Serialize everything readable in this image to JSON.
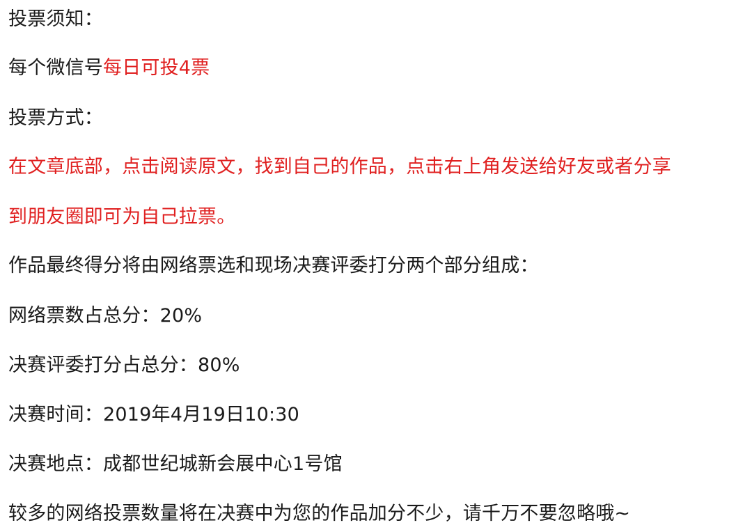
{
  "notice": {
    "title": "投票须知：",
    "rule_prefix": "每个微信号",
    "rule_highlight": "每日可投4票",
    "method_title": "投票方式：",
    "method_line1": "在文章底部，点击阅读原文，找到自己的作品，点击右上角发送给好友或者分享",
    "method_line2": "到朋友圈即可为自己拉票。",
    "score_intro": "作品最终得分将由网络票选和现场决赛评委打分两个部分组成：",
    "score_online": "网络票数占总分：20%",
    "score_judges": "决赛评委打分占总分：80%",
    "final_time": "决赛时间：2019年4月19日10:30",
    "final_place": "决赛地点：成都世纪城新会展中心1号馆",
    "closing": "较多的网络投票数量将在决赛中为您的作品加分不少，请千万不要忽略哦~"
  },
  "colors": {
    "text": "#1a1a1a",
    "highlight": "#e02020",
    "background": "#ffffff"
  }
}
